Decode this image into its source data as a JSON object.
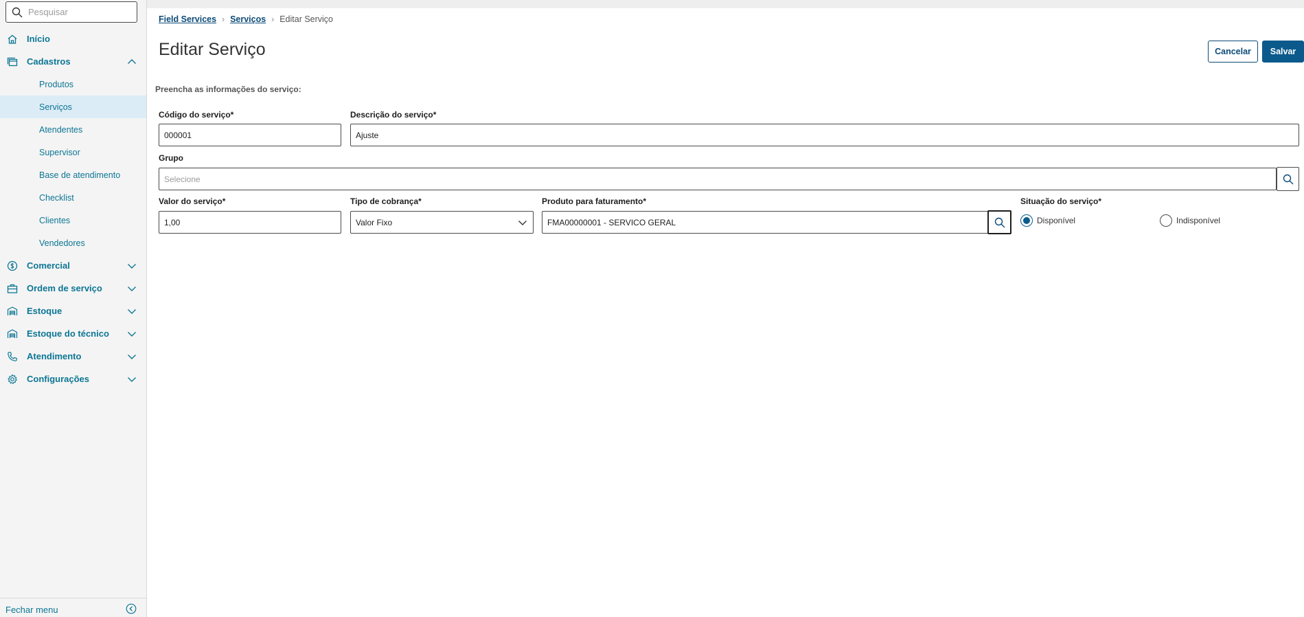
{
  "sidebar": {
    "search_placeholder": "Pesquisar",
    "items": [
      {
        "label": "Início",
        "icon": "home-icon"
      },
      {
        "label": "Cadastros",
        "icon": "cadastros-icon",
        "expanded": true
      },
      {
        "label": "Comercial",
        "icon": "dollar-circle-icon"
      },
      {
        "label": "Ordem de serviço",
        "icon": "briefcase-icon"
      },
      {
        "label": "Estoque",
        "icon": "warehouse-icon"
      },
      {
        "label": "Estoque do técnico",
        "icon": "warehouse-icon"
      },
      {
        "label": "Atendimento",
        "icon": "phone-icon"
      },
      {
        "label": "Configurações",
        "icon": "gear-icon"
      }
    ],
    "subitems": [
      "Produtos",
      "Serviços",
      "Atendentes",
      "Supervisor",
      "Base de atendimento",
      "Checklist",
      "Clientes",
      "Vendedores"
    ],
    "active_subitem": "Serviços",
    "close_menu_label": "Fechar menu"
  },
  "breadcrumb": {
    "items": [
      "Field Services",
      "Serviços"
    ],
    "current": "Editar Serviço"
  },
  "page": {
    "title": "Editar Serviço",
    "instructions": "Preencha as informações do serviço:"
  },
  "actions": {
    "cancel_label": "Cancelar",
    "save_label": "Salvar"
  },
  "form": {
    "codigo": {
      "label": "Código do serviço*",
      "value": "000001"
    },
    "descricao": {
      "label": "Descrição do serviço*",
      "value": "Ajuste"
    },
    "grupo": {
      "label": "Grupo",
      "placeholder": "Selecione"
    },
    "valor": {
      "label": "Valor do serviço*",
      "value": "1,00"
    },
    "tipo_cobranca": {
      "label": "Tipo de cobrança*",
      "value": "Valor Fixo"
    },
    "produto": {
      "label": "Produto para faturamento*",
      "value": "FMA00000001 - SERVICO GERAL"
    },
    "situacao": {
      "label": "Situação do serviço*",
      "options": [
        "Disponível",
        "Indisponível"
      ],
      "selected": "Disponível"
    }
  },
  "colors": {
    "accent": "#0c7694",
    "primary": "#0c5a8c",
    "active_bg": "#dcecf7"
  }
}
